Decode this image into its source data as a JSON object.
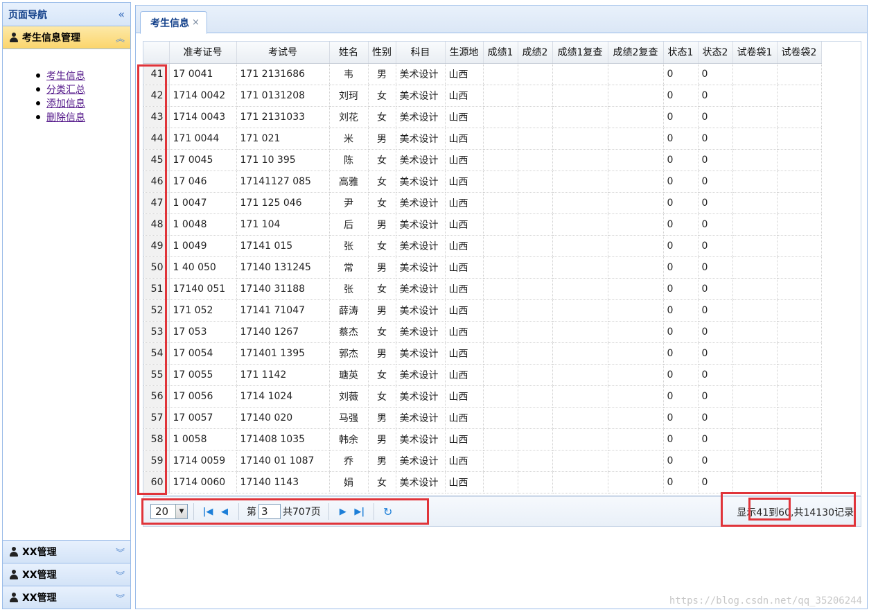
{
  "nav": {
    "title": "页面导航",
    "section_active": "考生信息管理",
    "menu": [
      "考生信息",
      "分类汇总",
      "添加信息",
      "删除信息"
    ],
    "other_sections": [
      "XX管理",
      "XX管理",
      "XX管理"
    ]
  },
  "tab": {
    "label": "考生信息",
    "close": "×"
  },
  "grid": {
    "columns": [
      "准考证号",
      "考试号",
      "姓名",
      "性别",
      "科目",
      "生源地",
      "成绩1",
      "成绩2",
      "成绩1复查",
      "成绩2复查",
      "状态1",
      "状态2",
      "试卷袋1",
      "试卷袋2"
    ],
    "rows": [
      {
        "n": "41",
        "zk": "17 0041",
        "ks": "171 2131686",
        "name": "韦",
        "sex": "男",
        "subj": "美术设计",
        "src": "山西",
        "s1": "0",
        "s2": "0"
      },
      {
        "n": "42",
        "zk": "1714 0042",
        "ks": "171 0131208",
        "name": "刘珂",
        "sex": "女",
        "subj": "美术设计",
        "src": "山西",
        "s1": "0",
        "s2": "0"
      },
      {
        "n": "43",
        "zk": "1714 0043",
        "ks": "171 2131033",
        "name": "刘花",
        "sex": "女",
        "subj": "美术设计",
        "src": "山西",
        "s1": "0",
        "s2": "0"
      },
      {
        "n": "44",
        "zk": "171 0044",
        "ks": "171 021",
        "name": "米",
        "sex": "男",
        "subj": "美术设计",
        "src": "山西",
        "s1": "0",
        "s2": "0"
      },
      {
        "n": "45",
        "zk": "17 0045",
        "ks": "171 10 395",
        "name": "陈",
        "sex": "女",
        "subj": "美术设计",
        "src": "山西",
        "s1": "0",
        "s2": "0"
      },
      {
        "n": "46",
        "zk": "17 046",
        "ks": "17141127 085",
        "name": "高雅",
        "sex": "女",
        "subj": "美术设计",
        "src": "山西",
        "s1": "0",
        "s2": "0"
      },
      {
        "n": "47",
        "zk": "1 0047",
        "ks": "171 125 046",
        "name": "尹",
        "sex": "女",
        "subj": "美术设计",
        "src": "山西",
        "s1": "0",
        "s2": "0"
      },
      {
        "n": "48",
        "zk": "1 0048",
        "ks": "171 104",
        "name": "后",
        "sex": "男",
        "subj": "美术设计",
        "src": "山西",
        "s1": "0",
        "s2": "0"
      },
      {
        "n": "49",
        "zk": "1 0049",
        "ks": "17141 015",
        "name": "张",
        "sex": "女",
        "subj": "美术设计",
        "src": "山西",
        "s1": "0",
        "s2": "0"
      },
      {
        "n": "50",
        "zk": "1 40 050",
        "ks": "17140 131245",
        "name": "常",
        "sex": "男",
        "subj": "美术设计",
        "src": "山西",
        "s1": "0",
        "s2": "0"
      },
      {
        "n": "51",
        "zk": "17140 051",
        "ks": "17140 31188",
        "name": "张",
        "sex": "女",
        "subj": "美术设计",
        "src": "山西",
        "s1": "0",
        "s2": "0"
      },
      {
        "n": "52",
        "zk": "171 052",
        "ks": "17141 71047",
        "name": "薛涛",
        "sex": "男",
        "subj": "美术设计",
        "src": "山西",
        "s1": "0",
        "s2": "0"
      },
      {
        "n": "53",
        "zk": "17 053",
        "ks": "17140 1267",
        "name": "蔡杰",
        "sex": "女",
        "subj": "美术设计",
        "src": "山西",
        "s1": "0",
        "s2": "0"
      },
      {
        "n": "54",
        "zk": "17 0054",
        "ks": "171401 1395",
        "name": "郭杰",
        "sex": "男",
        "subj": "美术设计",
        "src": "山西",
        "s1": "0",
        "s2": "0"
      },
      {
        "n": "55",
        "zk": "17 0055",
        "ks": "171 1142",
        "name": "瑭英",
        "sex": "女",
        "subj": "美术设计",
        "src": "山西",
        "s1": "0",
        "s2": "0"
      },
      {
        "n": "56",
        "zk": "17 0056",
        "ks": "1714 1024",
        "name": "刘薇",
        "sex": "女",
        "subj": "美术设计",
        "src": "山西",
        "s1": "0",
        "s2": "0"
      },
      {
        "n": "57",
        "zk": "17 0057",
        "ks": "17140 020",
        "name": "马强",
        "sex": "男",
        "subj": "美术设计",
        "src": "山西",
        "s1": "0",
        "s2": "0"
      },
      {
        "n": "58",
        "zk": "1 0058",
        "ks": "171408 1035",
        "name": "韩余",
        "sex": "男",
        "subj": "美术设计",
        "src": "山西",
        "s1": "0",
        "s2": "0"
      },
      {
        "n": "59",
        "zk": "1714 0059",
        "ks": "17140 01 1087",
        "name": "乔",
        "sex": "男",
        "subj": "美术设计",
        "src": "山西",
        "s1": "0",
        "s2": "0"
      },
      {
        "n": "60",
        "zk": "1714 0060",
        "ks": "17140 1143",
        "name": "娟",
        "sex": "女",
        "subj": "美术设计",
        "src": "山西",
        "s1": "0",
        "s2": "0"
      }
    ]
  },
  "pager": {
    "page_size": "20",
    "page_prefix": "第",
    "page_value": "3",
    "page_total": "共707页",
    "info_prefix": "显示",
    "info_range": "41到60,",
    "info_suffix": "共14130记录"
  },
  "watermark": "https://blog.csdn.net/qq_35206244",
  "colors": {
    "highlight": "#e0343a",
    "accent": "#15428b",
    "active_section": "#fbd56b"
  }
}
